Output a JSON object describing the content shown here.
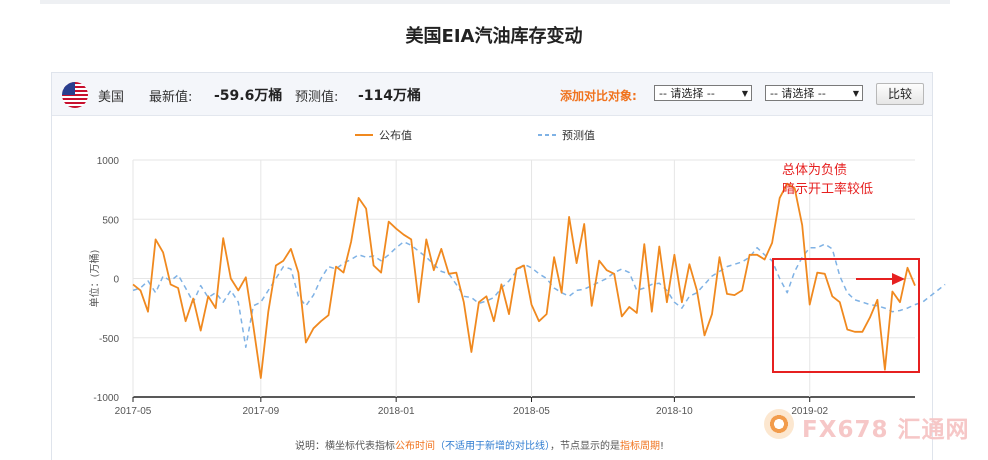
{
  "page": {
    "title": "美国EIA汽油库存变动"
  },
  "toolbar": {
    "country": "美国",
    "latest_label": "最新值:",
    "latest_value": "-59.6万桶",
    "forecast_label": "预测值:",
    "forecast_value": "-114万桶",
    "compare_label": "添加对比对象:",
    "select1": "-- 请选择 --",
    "select2": "-- 请选择 --",
    "compare_button": "比较"
  },
  "note": {
    "prefix": "说明：横坐标代表指标",
    "highlight1": "公布时间",
    "middle": "（不适用于新增的对比线）",
    "tail": "，节点显示的是",
    "highlight2": "指标周期",
    "end": "!"
  },
  "annotation": {
    "line1": "总体为负债",
    "line2": "暗示开工率较低"
  },
  "watermark": {
    "text": "FX678 汇通网"
  },
  "colors": {
    "actual": "#f0891f",
    "forecast": "#7fb2e5",
    "annotation": "#e62020",
    "accent": "#f0731e"
  },
  "chart_data": {
    "type": "line",
    "title": "",
    "xlabel": "",
    "ylabel": "单位：(万桶)",
    "ylim": [
      -1000,
      1000
    ],
    "yticks": [
      1000,
      500,
      0,
      -500,
      -1000
    ],
    "x_ticks": [
      "2017-05",
      "2017-09",
      "2018-01",
      "2018-05",
      "2018-10",
      "2019-02"
    ],
    "x_tick_positions": [
      0,
      17,
      35,
      53,
      72,
      90
    ],
    "grid": true,
    "legend": "top-center",
    "series": [
      {
        "name": "公布值",
        "style": "solid",
        "values": [
          -50,
          -100,
          -280,
          330,
          220,
          -50,
          -80,
          -360,
          -170,
          -440,
          -150,
          -250,
          340,
          0,
          -100,
          10,
          -400,
          -840,
          -280,
          110,
          150,
          250,
          50,
          -540,
          -420,
          -360,
          -310,
          100,
          50,
          310,
          680,
          590,
          110,
          50,
          480,
          420,
          370,
          330,
          -200,
          330,
          70,
          250,
          40,
          50,
          -200,
          -620,
          -200,
          -150,
          -360,
          -50,
          -300,
          80,
          110,
          -220,
          -360,
          -300,
          180,
          -120,
          520,
          130,
          460,
          -230,
          150,
          70,
          40,
          -320,
          -240,
          -290,
          290,
          -280,
          270,
          -200,
          200,
          -200,
          120,
          -100,
          -480,
          -300,
          180,
          -130,
          -140,
          -100,
          200,
          200,
          160,
          300,
          680,
          800,
          760,
          450,
          -220,
          50,
          40,
          -150,
          -200,
          -430,
          -450,
          -450,
          -330,
          -180,
          -770,
          -110,
          -200,
          90,
          -60
        ]
      },
      {
        "name": "预测值",
        "style": "dashed",
        "values": [
          -100,
          -80,
          -20,
          -120,
          20,
          -20,
          30,
          -80,
          -200,
          -60,
          -160,
          -120,
          -200,
          -100,
          -200,
          -580,
          -230,
          -200,
          -100,
          0,
          100,
          80,
          -150,
          -230,
          -140,
          0,
          100,
          80,
          130,
          160,
          200,
          180,
          190,
          150,
          200,
          260,
          310,
          280,
          230,
          180,
          120,
          60,
          40,
          -50,
          -150,
          -160,
          -210,
          -190,
          -160,
          -80,
          -20,
          60,
          120,
          90,
          40,
          0,
          -80,
          -120,
          -150,
          -100,
          -90,
          -60,
          -30,
          0,
          50,
          80,
          50,
          -100,
          -80,
          -50,
          -40,
          -100,
          -200,
          -250,
          -150,
          -120,
          -50,
          20,
          60,
          100,
          120,
          140,
          180,
          260,
          200,
          150,
          0,
          -120,
          60,
          180,
          260,
          260,
          290,
          250,
          20,
          -120,
          -180,
          -200,
          -220,
          -230,
          -250,
          -280,
          -270,
          -250,
          -220,
          -200,
          -150,
          -100,
          -50
        ]
      }
    ]
  }
}
